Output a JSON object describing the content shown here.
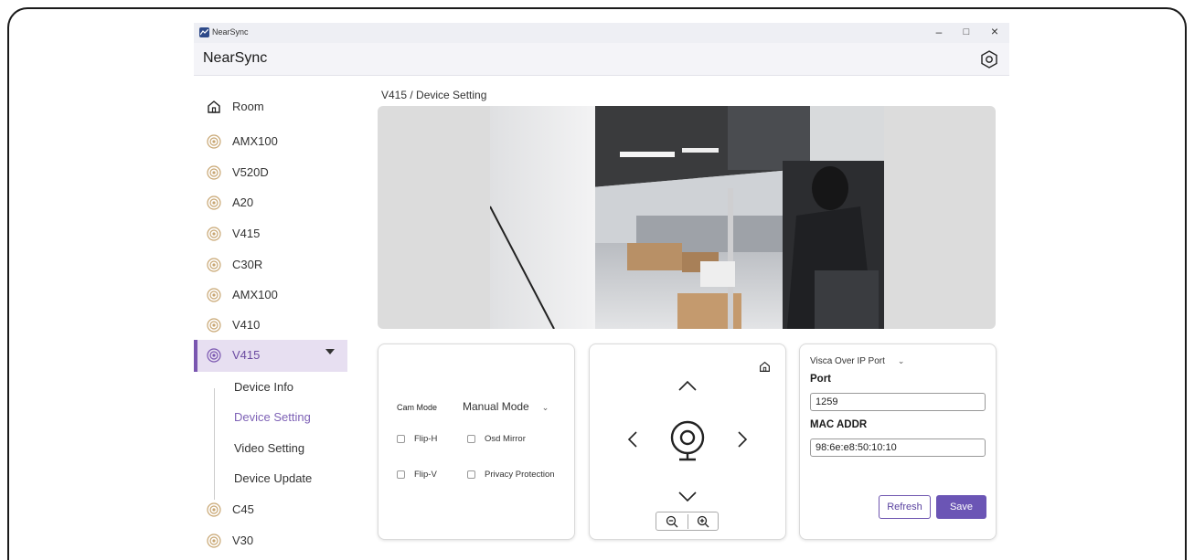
{
  "window": {
    "title": "NearSync",
    "minimize": "–",
    "maximize": "□",
    "close": "×"
  },
  "app": {
    "name": "NearSync"
  },
  "sidebar": {
    "items": [
      {
        "label": "Room",
        "icon": "home-icon"
      },
      {
        "label": "AMX100",
        "icon": "device-icon"
      },
      {
        "label": "V520D",
        "icon": "device-icon"
      },
      {
        "label": "A20",
        "icon": "device-icon"
      },
      {
        "label": "V415",
        "icon": "device-icon"
      },
      {
        "label": "C30R",
        "icon": "device-icon"
      },
      {
        "label": "AMX100",
        "icon": "device-icon"
      },
      {
        "label": "V410",
        "icon": "device-icon"
      },
      {
        "label": "V415",
        "icon": "device-icon",
        "active": true
      },
      {
        "label": "C45",
        "icon": "device-icon"
      },
      {
        "label": "V30",
        "icon": "device-icon"
      }
    ],
    "subitems": [
      {
        "label": "Device Info"
      },
      {
        "label": "Device Setting",
        "selected": true
      },
      {
        "label": "Video Setting"
      },
      {
        "label": "Device Update"
      }
    ]
  },
  "breadcrumb": "V415 / Device Setting",
  "camera": {
    "cam_mode_label": "Cam Mode",
    "mode_value": "Manual Mode",
    "flip_h": "Flip-H",
    "osd_mirror": "Osd Mirror",
    "flip_v": "Flip-V",
    "privacy": "Privacy Protection"
  },
  "ptz": {
    "up": "^",
    "down": "v",
    "left": "<",
    "right": ">"
  },
  "network": {
    "protocol": "Visca Over IP Port",
    "port_label": "Port",
    "port_value": "1259",
    "mac_label": "MAC ADDR",
    "mac_value": "98:6e:e8:50:10:10",
    "refresh": "Refresh",
    "save": "Save"
  },
  "colors": {
    "accent": "#6b55b5",
    "active_bg": "#e7dff1",
    "device_icon": "#c8a672"
  }
}
